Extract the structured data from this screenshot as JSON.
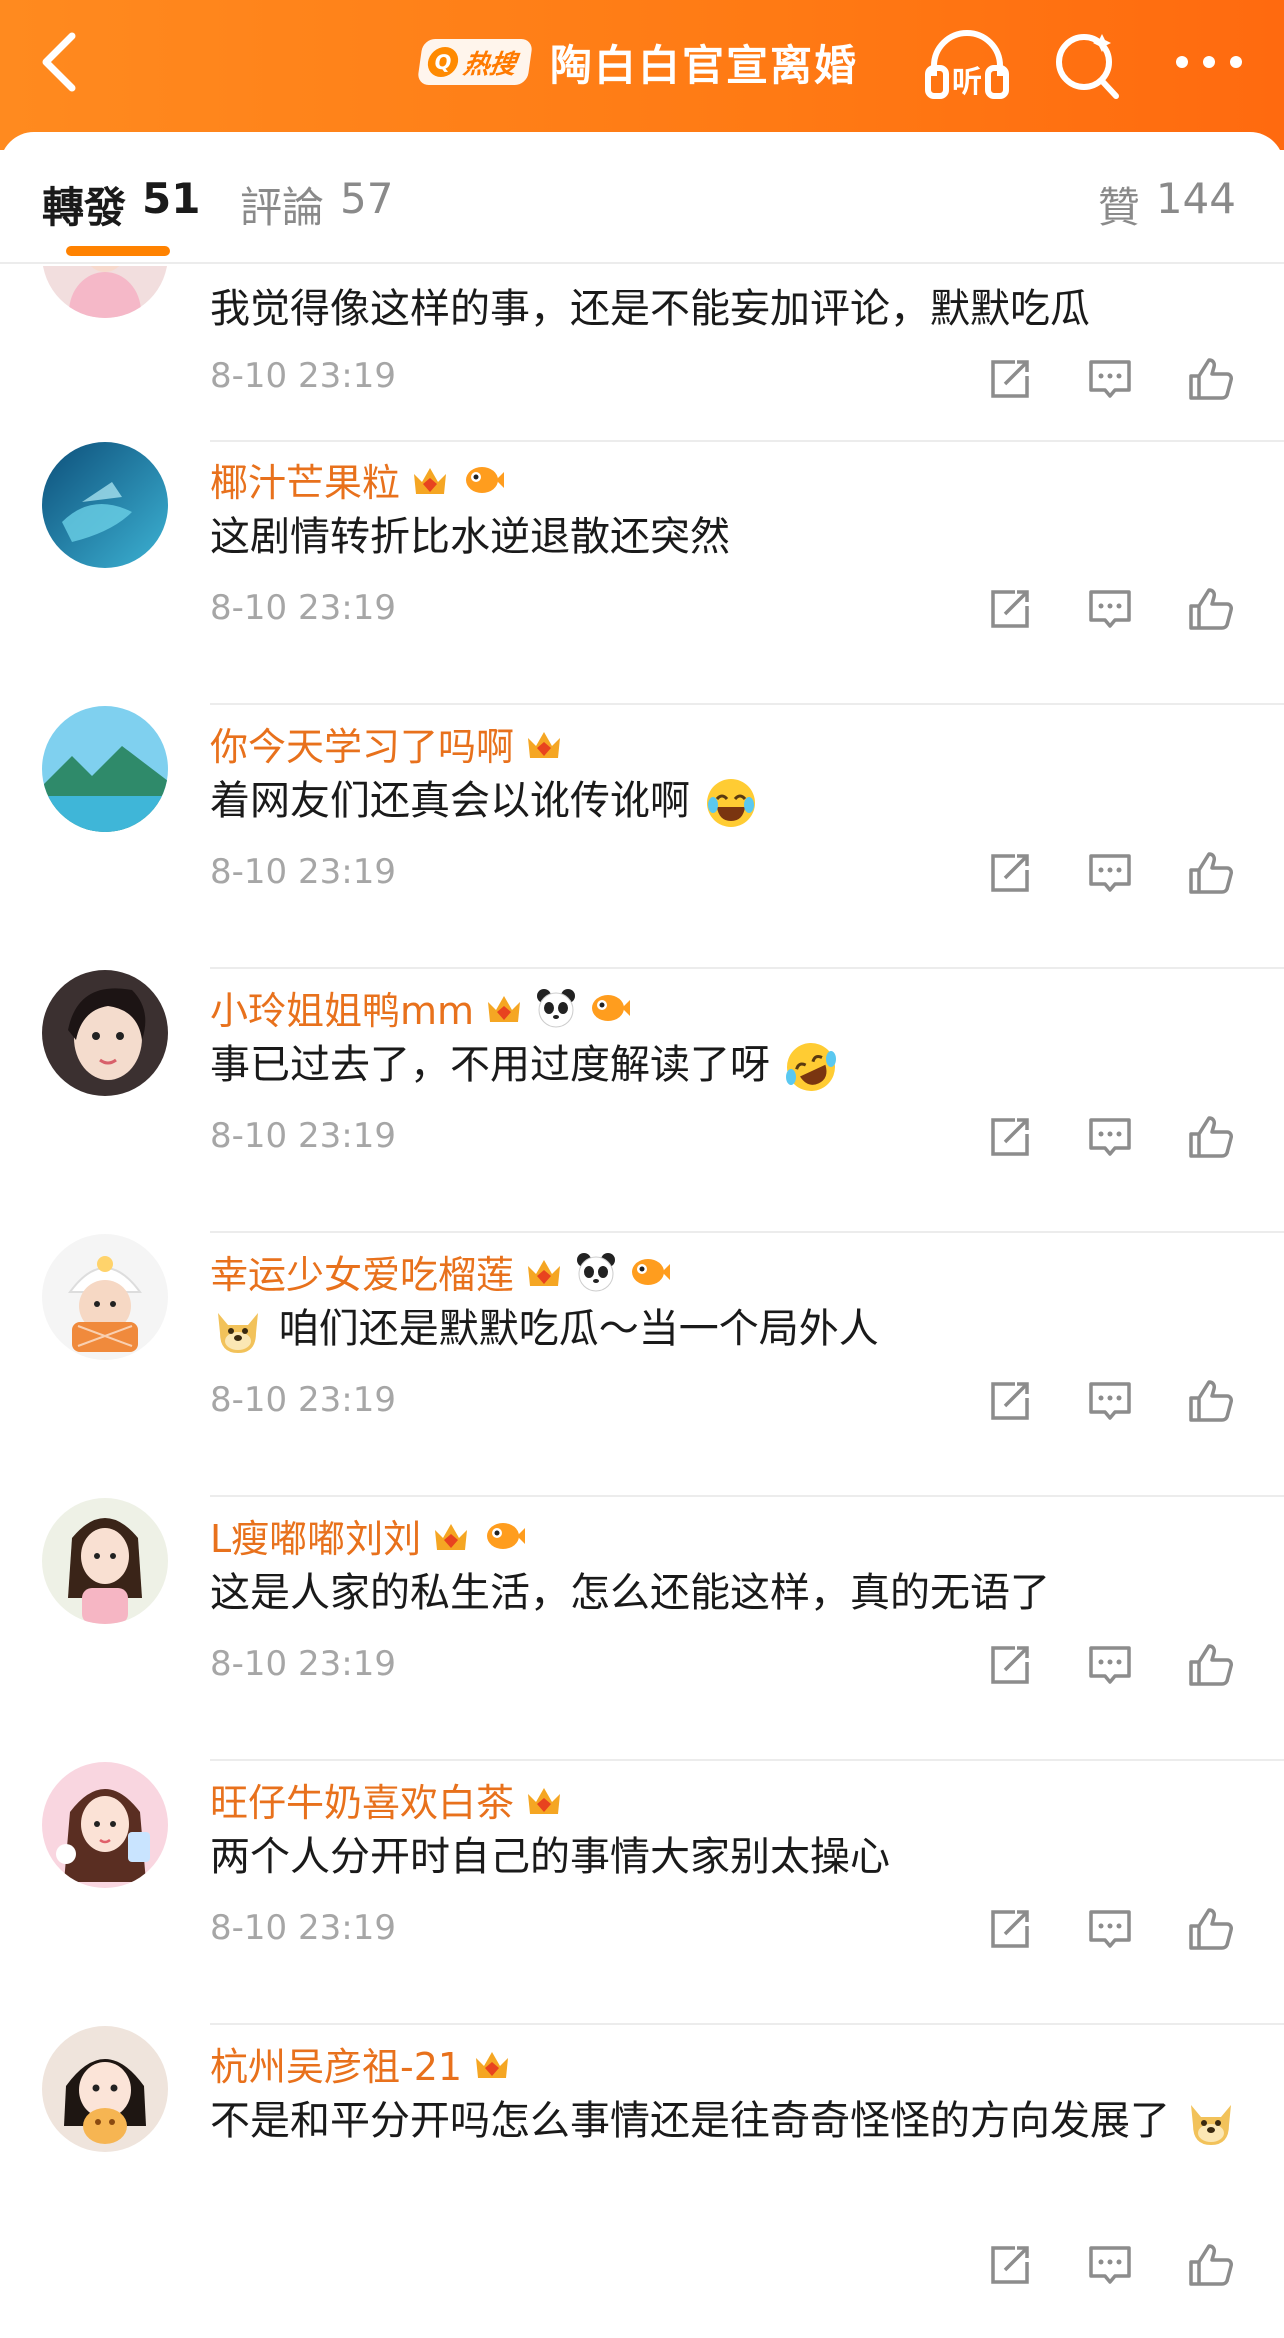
{
  "header": {
    "hot_label": "热搜",
    "title": "陶白白官宣离婚",
    "listen_label": "听",
    "bg_color": "#ff7a14"
  },
  "tabs": {
    "repost": {
      "label": "轉發",
      "count": "51"
    },
    "comment": {
      "label": "評論",
      "count": "57"
    },
    "like": {
      "label": "贊",
      "count": "144"
    }
  },
  "comments": [
    {
      "user": "",
      "text": "我觉得像这样的事，还是不能妄加评论，默默吃瓜",
      "time": "8-10 23:19",
      "badges": []
    },
    {
      "user": "椰汁芒果粒",
      "text": "这剧情转折比水逆退散还突然",
      "time": "8-10 23:19",
      "badges": [
        "vip-crown-icon",
        "fish-icon"
      ]
    },
    {
      "user": "你今天学习了吗啊",
      "text": "着网友们还真会以讹传讹啊",
      "time": "8-10 23:19",
      "badges": [
        "vip-crown-icon"
      ],
      "emoji": "laugh-tears-emoji"
    },
    {
      "user": "小玲姐姐鸭mm",
      "text": "事已过去了，不用过度解读了呀",
      "time": "8-10 23:19",
      "badges": [
        "vip-crown-icon",
        "panda-icon",
        "fish-icon"
      ],
      "emoji": "rolling-laugh-emoji"
    },
    {
      "user": "幸运少女爱吃榴莲",
      "text": "咱们还是默默吃瓜～当一个局外人",
      "time": "8-10 23:19",
      "badges": [
        "vip-crown-icon",
        "panda-icon",
        "fish-icon"
      ],
      "emoji_before": "doge-emoji"
    },
    {
      "user": "L瘦嘟嘟刘刘",
      "text": "这是人家的私生活，怎么还能这样，真的无语了",
      "time": "8-10 23:19",
      "badges": [
        "vip-crown-icon",
        "fish-icon"
      ]
    },
    {
      "user": "旺仔牛奶喜欢白茶",
      "text": "两个人分开时自己的事情大家别太操心",
      "time": "8-10 23:19",
      "badges": [
        "vip-crown-icon"
      ]
    },
    {
      "user": "杭州吴彦祖-21",
      "text": "不是和平分开吗怎么事情还是往奇奇怪怪的方向发展了",
      "time": "",
      "badges": [
        "vip-crown-icon"
      ],
      "emoji": "doge-emoji"
    }
  ]
}
